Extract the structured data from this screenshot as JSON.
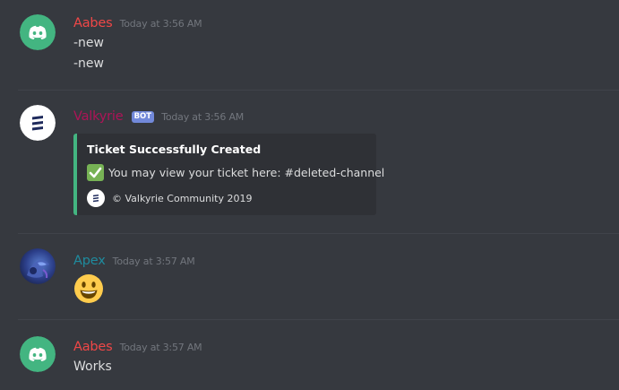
{
  "messages": [
    {
      "username": "Aabes",
      "username_color": "#f04747",
      "timestamp": "Today at 3:56 AM",
      "avatar": "discord-logo-icon",
      "avatar_color": "#43b581",
      "lines": [
        "-new",
        "-new"
      ]
    },
    {
      "username": "Valkyrie",
      "username_color": "#ad1457",
      "bot_tag": "BOT",
      "timestamp": "Today at 3:56 AM",
      "avatar": "valkyrie-logo-icon",
      "embed": {
        "accent": "#43b581",
        "title": "Ticket Successfully Created",
        "check_icon": "white-check-mark-icon",
        "description": "You may view your ticket here: #deleted-channel",
        "footer_icon": "valkyrie-logo-icon",
        "footer": "© Valkyrie Community 2019"
      }
    },
    {
      "username": "Apex",
      "username_color": "#1f8b9e",
      "timestamp": "Today at 3:57 AM",
      "avatar": "apex-avatar-image",
      "emoji": "smiley-emoji-icon"
    },
    {
      "username": "Aabes",
      "username_color": "#f04747",
      "timestamp": "Today at 3:57 AM",
      "avatar": "discord-logo-icon",
      "avatar_color": "#43b581",
      "lines": [
        "Works"
      ]
    }
  ]
}
